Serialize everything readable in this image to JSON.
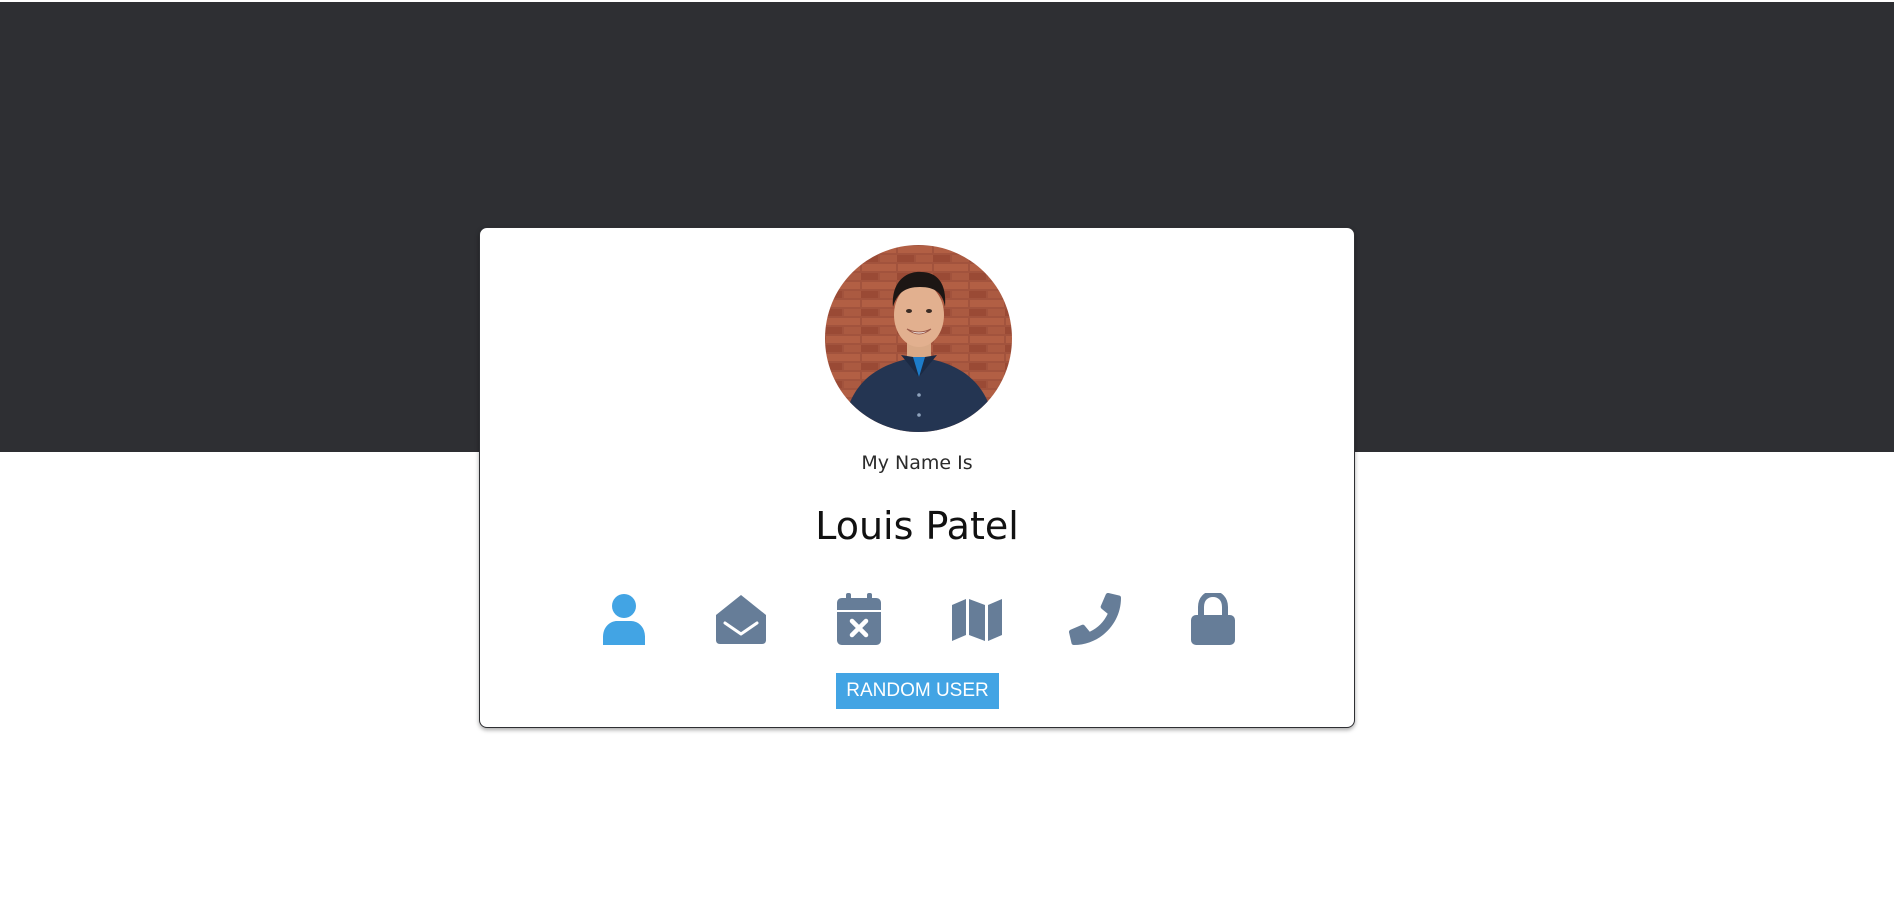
{
  "card": {
    "subtitle": "My Name Is",
    "name": "Louis Patel",
    "button_label": "RANDOM USER"
  },
  "icons": [
    {
      "name": "user-icon",
      "active": true
    },
    {
      "name": "envelope-open-icon",
      "active": false
    },
    {
      "name": "calendar-icon",
      "active": false
    },
    {
      "name": "map-icon",
      "active": false
    },
    {
      "name": "phone-icon",
      "active": false
    },
    {
      "name": "lock-icon",
      "active": false
    }
  ],
  "colors": {
    "header_bg": "#2e2f33",
    "accent": "#42a4e4",
    "icon_inactive": "#667d98"
  }
}
